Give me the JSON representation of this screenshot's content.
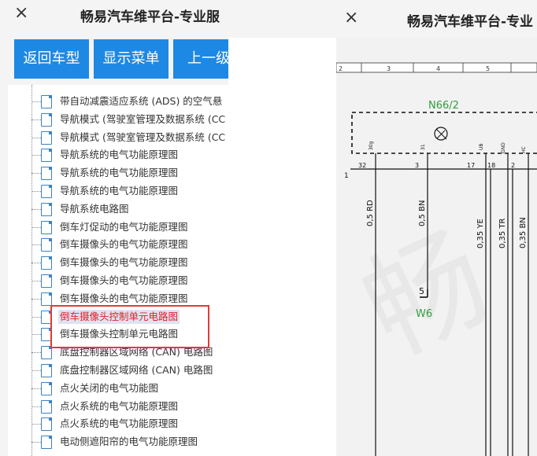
{
  "left_panel": {
    "close_glyph": "×",
    "title": "畅易汽车维平台-专业服",
    "buttons": {
      "back": "返回车型",
      "menu": "显示菜单",
      "prev": "上一级"
    },
    "tree_items": [
      "带自动减震适应系统 (ADS) 的空气悬",
      "导航模式 (驾驶室管理及数据系统 (CC",
      "导航模式 (驾驶室管理及数据系统 (CC",
      "导航系统的电气功能原理图",
      "导航系统的电气功能原理图",
      "导航系统的电气功能原理图",
      "导航系统电路图",
      "倒车灯促动的电气功能原理图",
      "倒车摄像头的电气功能原理图",
      "倒车摄像头的电气功能原理图",
      "倒车摄像头的电气功能原理图",
      "倒车摄像头的电气功能原理图",
      "倒车摄像头控制单元电路图",
      "倒车摄像头控制单元电路图",
      "底盘控制器区域网络 (CAN) 电路图",
      "底盘控制器区域网络 (CAN) 电路图",
      "点火关闭的电气功能图",
      "点火系统的电气功能原理图",
      "点火系统的电气功能原理图",
      "电动侧遮阳帘的电气功能原理图"
    ],
    "selected_index": 12
  },
  "right_panel": {
    "close_glyph": "×",
    "title": "畅易汽车维平台-专业",
    "diagram": {
      "ruler_numbers": [
        "2",
        "3",
        "4",
        "5"
      ],
      "component_label": "N66/2",
      "row_marker": "1",
      "pin_numbers": [
        "32",
        "3",
        "17",
        "18",
        "2"
      ],
      "pin_signals": [
        "30g",
        "31",
        "UB",
        "GND",
        "HC"
      ],
      "wire_labels": [
        "0,5 RD",
        "0,5 BN",
        "0,35 YE",
        "0,35 TR",
        "0,35 BN"
      ],
      "ground_pin": "5",
      "ground_label": "W6"
    }
  },
  "colors": {
    "button": "#1e88e5",
    "highlight_box": "#e53935",
    "selected_text": "#e0202a",
    "diagram_green": "#2e9e3e"
  }
}
